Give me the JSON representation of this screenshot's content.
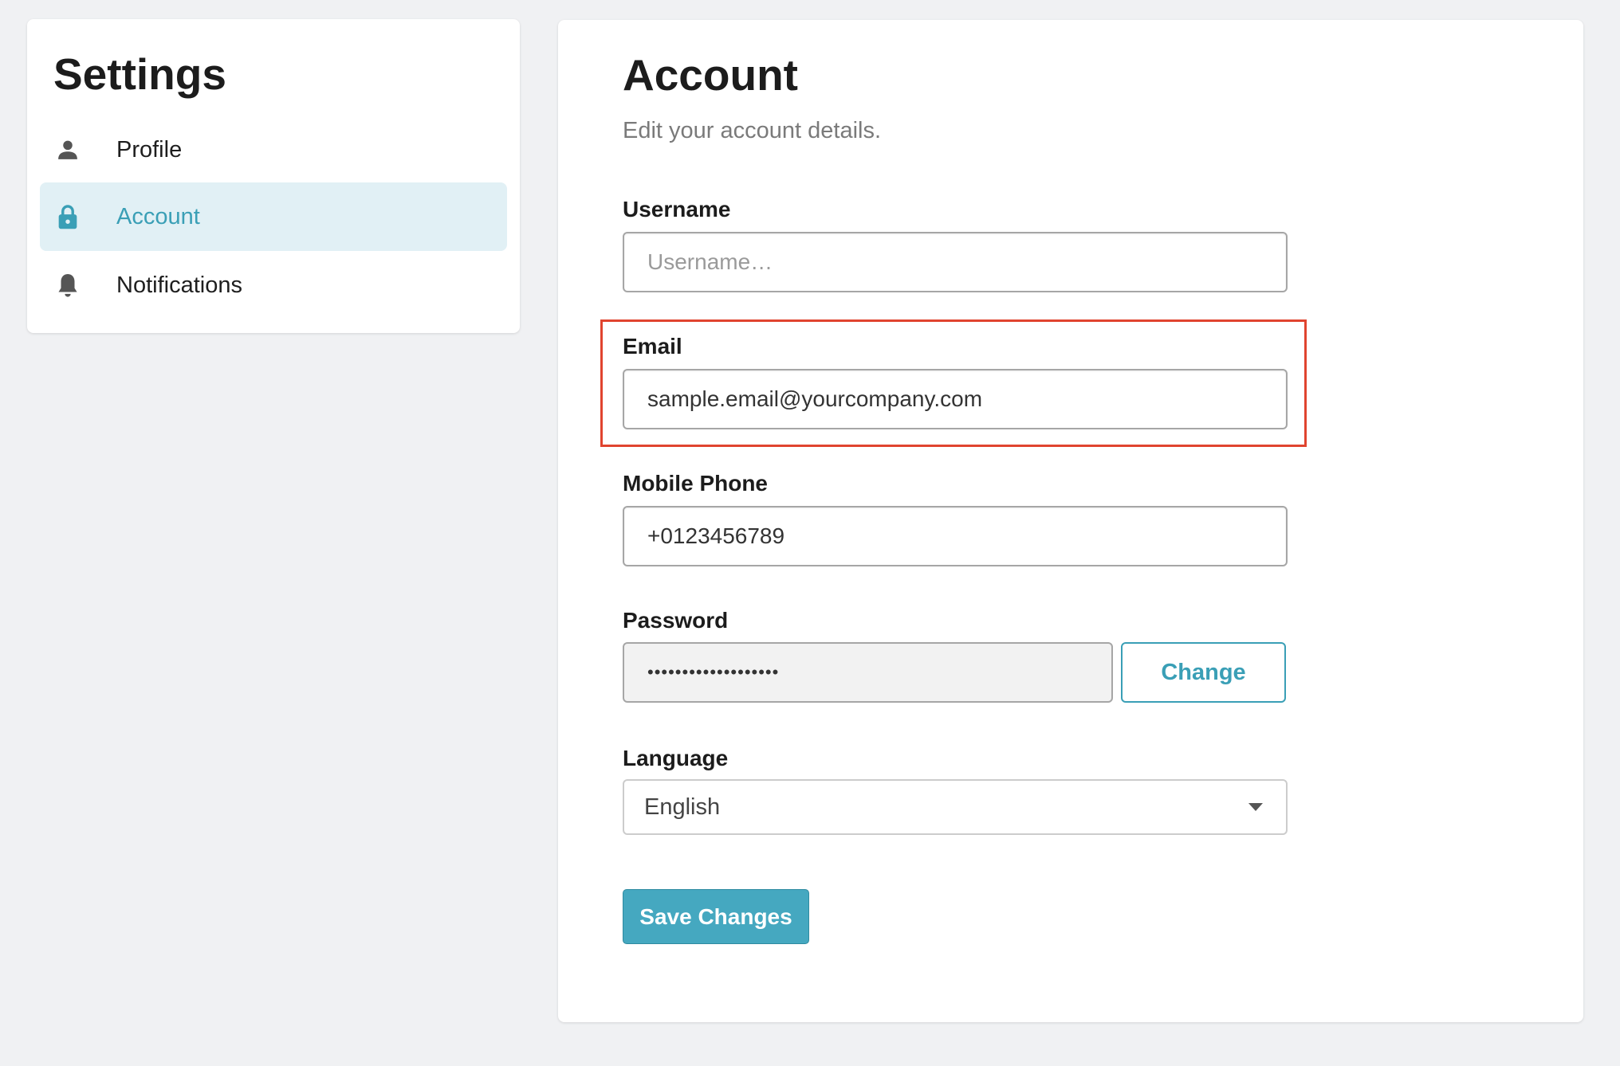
{
  "sidebar": {
    "title": "Settings",
    "items": [
      {
        "label": "Profile",
        "icon": "person-icon",
        "active": false
      },
      {
        "label": "Account",
        "icon": "lock-icon",
        "active": true
      },
      {
        "label": "Notifications",
        "icon": "bell-icon",
        "active": false
      }
    ]
  },
  "main": {
    "title": "Account",
    "subtitle": "Edit your account details.",
    "username": {
      "label": "Username",
      "value": "",
      "placeholder": "Username…"
    },
    "email": {
      "label": "Email",
      "value": "sample.email@yourcompany.com"
    },
    "phone": {
      "label": "Mobile Phone",
      "value": "+0123456789"
    },
    "password": {
      "label": "Password",
      "masked_value": "•••••••••••••••••••",
      "change_label": "Change"
    },
    "language": {
      "label": "Language",
      "selected": "English"
    },
    "save_label": "Save Changes"
  },
  "colors": {
    "accent": "#45a8c0",
    "accent_text": "#3a9fb6",
    "active_item_bg": "#e1f0f5",
    "highlight": "#e0442f",
    "page_bg": "#f0f1f3"
  }
}
